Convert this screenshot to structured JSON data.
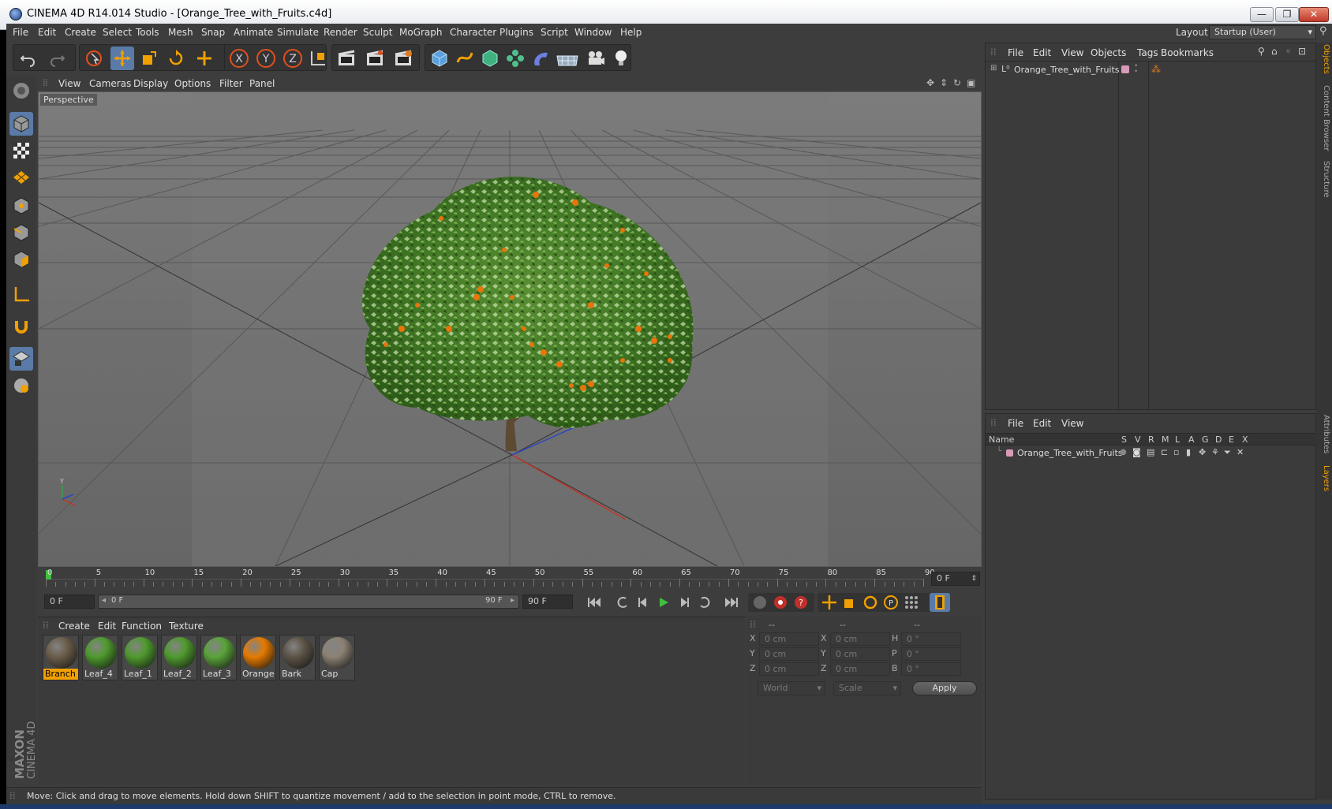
{
  "window": {
    "title": "CINEMA 4D R14.014 Studio - [Orange_Tree_with_Fruits.c4d]",
    "minimize": "—",
    "restore": "❐",
    "close": "✕"
  },
  "menu": [
    "File",
    "Edit",
    "Create",
    "Select",
    "Tools",
    "Mesh",
    "Snap",
    "Animate",
    "Simulate",
    "Render",
    "Sculpt",
    "MoGraph",
    "Character",
    "Plugins",
    "Script",
    "Window",
    "Help"
  ],
  "layout": {
    "label": "Layout:",
    "value": "Startup (User)"
  },
  "viewport": {
    "menu": [
      "View",
      "Cameras",
      "Display",
      "Options",
      "Filter",
      "Panel"
    ],
    "label": "Perspective"
  },
  "timeline": {
    "ticks": [
      "0",
      "5",
      "10",
      "15",
      "20",
      "25",
      "30",
      "35",
      "40",
      "45",
      "50",
      "55",
      "60",
      "65",
      "70",
      "75",
      "80",
      "85",
      "90"
    ],
    "current_frame": "0 F"
  },
  "transport": {
    "start": "0 F",
    "range_start": "0 F",
    "range_end": "90 F",
    "end": "90 F"
  },
  "materials": {
    "menu": [
      "Create",
      "Edit",
      "Function",
      "Texture"
    ],
    "items": [
      {
        "name": "Branch",
        "color": "#6b5d4a",
        "selected": true
      },
      {
        "name": "Leaf_4",
        "color": "#4f9a2e",
        "selected": false
      },
      {
        "name": "Leaf_1",
        "color": "#4f9a2e",
        "selected": false
      },
      {
        "name": "Leaf_2",
        "color": "#4f9a2e",
        "selected": false
      },
      {
        "name": "Leaf_3",
        "color": "#5aa33a",
        "selected": false
      },
      {
        "name": "Orange",
        "color": "#e67a00",
        "selected": false
      },
      {
        "name": "Bark",
        "color": "#5d5447",
        "selected": false
      },
      {
        "name": "Cap",
        "color": "#8c8274",
        "selected": false
      }
    ]
  },
  "coords": {
    "headers": [
      "--",
      "--",
      "--"
    ],
    "rows": [
      {
        "l1": "X",
        "v1": "0 cm",
        "l2": "X",
        "v2": "0 cm",
        "l3": "H",
        "v3": "0 °"
      },
      {
        "l1": "Y",
        "v1": "0 cm",
        "l2": "Y",
        "v2": "0 cm",
        "l3": "P",
        "v3": "0 °"
      },
      {
        "l1": "Z",
        "v1": "0 cm",
        "l2": "Z",
        "v2": "0 cm",
        "l3": "B",
        "v3": "0 °"
      }
    ],
    "mode1": "World",
    "mode2": "Scale",
    "apply": "Apply"
  },
  "status": "Move: Click and drag to move elements. Hold down SHIFT to quantize movement / add to the selection in point mode, CTRL to remove.",
  "objects": {
    "menu": [
      "File",
      "Edit",
      "View",
      "Objects",
      "Tags",
      "Bookmarks"
    ],
    "item": "Orange_Tree_with_Fruits"
  },
  "layers": {
    "menu": [
      "File",
      "Edit",
      "View"
    ],
    "name_header": "Name",
    "columns": [
      "S",
      "V",
      "R",
      "M",
      "L",
      "A",
      "G",
      "D",
      "E",
      "X"
    ],
    "item": "Orange_Tree_with_Fruits"
  },
  "sidetabs": [
    "Objects",
    "Content Browser",
    "Structure",
    "Attributes",
    "Layers"
  ],
  "brand": {
    "line1": "MAXON",
    "line2": "CINEMA 4D"
  },
  "colors": {
    "accent": "#5a7ba8",
    "selection": "#f0a000",
    "bg": "#3d3d3d"
  }
}
